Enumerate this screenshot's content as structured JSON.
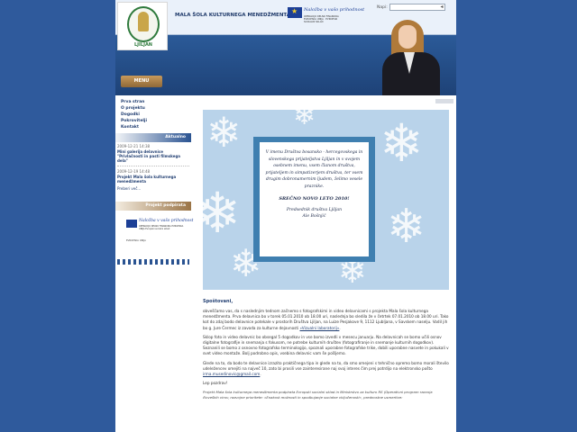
{
  "header": {
    "site_title": "MALA ŠOLA KULTURNEGA MENEDŽMENTA",
    "logo_text": "LJILJAN",
    "eu_title": "Naložba v vašo prihodnost",
    "eu_subtitle": "OPERACIJO DELNO FINANCIRA EVROPSKA UNIJA · EVROPSKI SOCIALNI SKLAD",
    "search_label": "Napi:",
    "search_value": "",
    "menu_label": "MENU"
  },
  "sidebar": {
    "nav": [
      "Prva stran",
      "O projektu",
      "Dogodki",
      "Pokrovitelji",
      "Kontakt"
    ],
    "news_header": "Aktualno",
    "news": [
      {
        "date": "2009-12-21 14:38",
        "title": "Mini galerija delavnice \"Privlačnosti in pasti filmskega dela\""
      },
      {
        "date": "2009-12-19 14:48",
        "title": "Projekt Mala šola kulturnega menedžmenta"
      }
    ],
    "more_link": "Preberi več...",
    "sponsors_header": "Projekt podpirata",
    "sponsor_title": "Naložba v vašo prihodnost",
    "sponsor_subtitle": "OPERACIJO DELNO FINANCIRA EVROPSKA UNIJA Evropski socialni sklad",
    "sponsor_eu_sub": "EVROPSKA UNIJA"
  },
  "card": {
    "text": "V imenu Društva bosansko - hercegovskega in slovenskega prijateljstva Ljiljan in v svojem osebnem imenu, vsem članom društva, prijateljem in simpatizerjem društva, ter vsem drugim dobronamernim ljudem, želimo vesele praznike.",
    "greeting": "SREČNO NOVO LETO 2010!",
    "signer_role": "Predsednik društva Ljiljan",
    "signer_name": "Ale Bošnjić"
  },
  "article": {
    "title": "Spoštovani,",
    "p1": "obveščamo vas, da s naslednjim tednom začnemo s fotografskimi in video delavnicami s projekta Mala šola kulturnega menedžmenta. Prva delavnica bo v torek 05.01.2010 ob 18.00 uri, naslednja bo sledila že v četrtek 07.01.2010 ob 18.00 uri. Tako kot do zdaj bodo delavnice potekale v prostorih Društva Ljiljan, na Luize Pesjakove 9, 1112 Ljubljana, v Savskem naselju. Vodil jih bo g. Jure Čermec iz zavoda za kulturne dejavnosti",
    "p1_link": "»Vizualni laboratorij«",
    "p1_end": ".",
    "p2": "Sklop foto in video delavnic bo obsegal 5 dogodkov in vse bomo izvedli v mesecu januarju. Na delavnicah se bomo učili osnov digitalne fotografije in snemanja s fokusom, ne potrebe kulturnih društev (fotografiranje in snemanje kulturnih dogodkov). Seznanili se bomo z osnovno fotografsko terminologijo, spoznali uporabne fotografske trike, dobili uporabne nasvete in pokukali v svet video montaže. Bolj podrobno opis, vsebina delavnic vam še pošljemo.",
    "p3": "Glede na to, da bodo te delavnice izrazito praktičnega tipa in glede na to, da smo omejeni s tehnično opremo bomo morali število udeležencev omejiti na največ 10, zato bi prosili vse zainteresirane naj svoj interes čim prej potrdijo na elektronsko pošto",
    "p3_link": "irma.musedinovic@gmail.com",
    "p3_end": ".",
    "p4": "Lep pozdrav!",
    "foot": "Projekt Mala šola kulturnega menedžmenta podpirata Evropski socialni sklad in Ministrstvo za kulturo RS (Operativni program razvoja človeških virov, razvojne prioritete: »Enakost možnosti in spodbujanje socialne vključenosti«, prednostne usmeritve:"
  }
}
